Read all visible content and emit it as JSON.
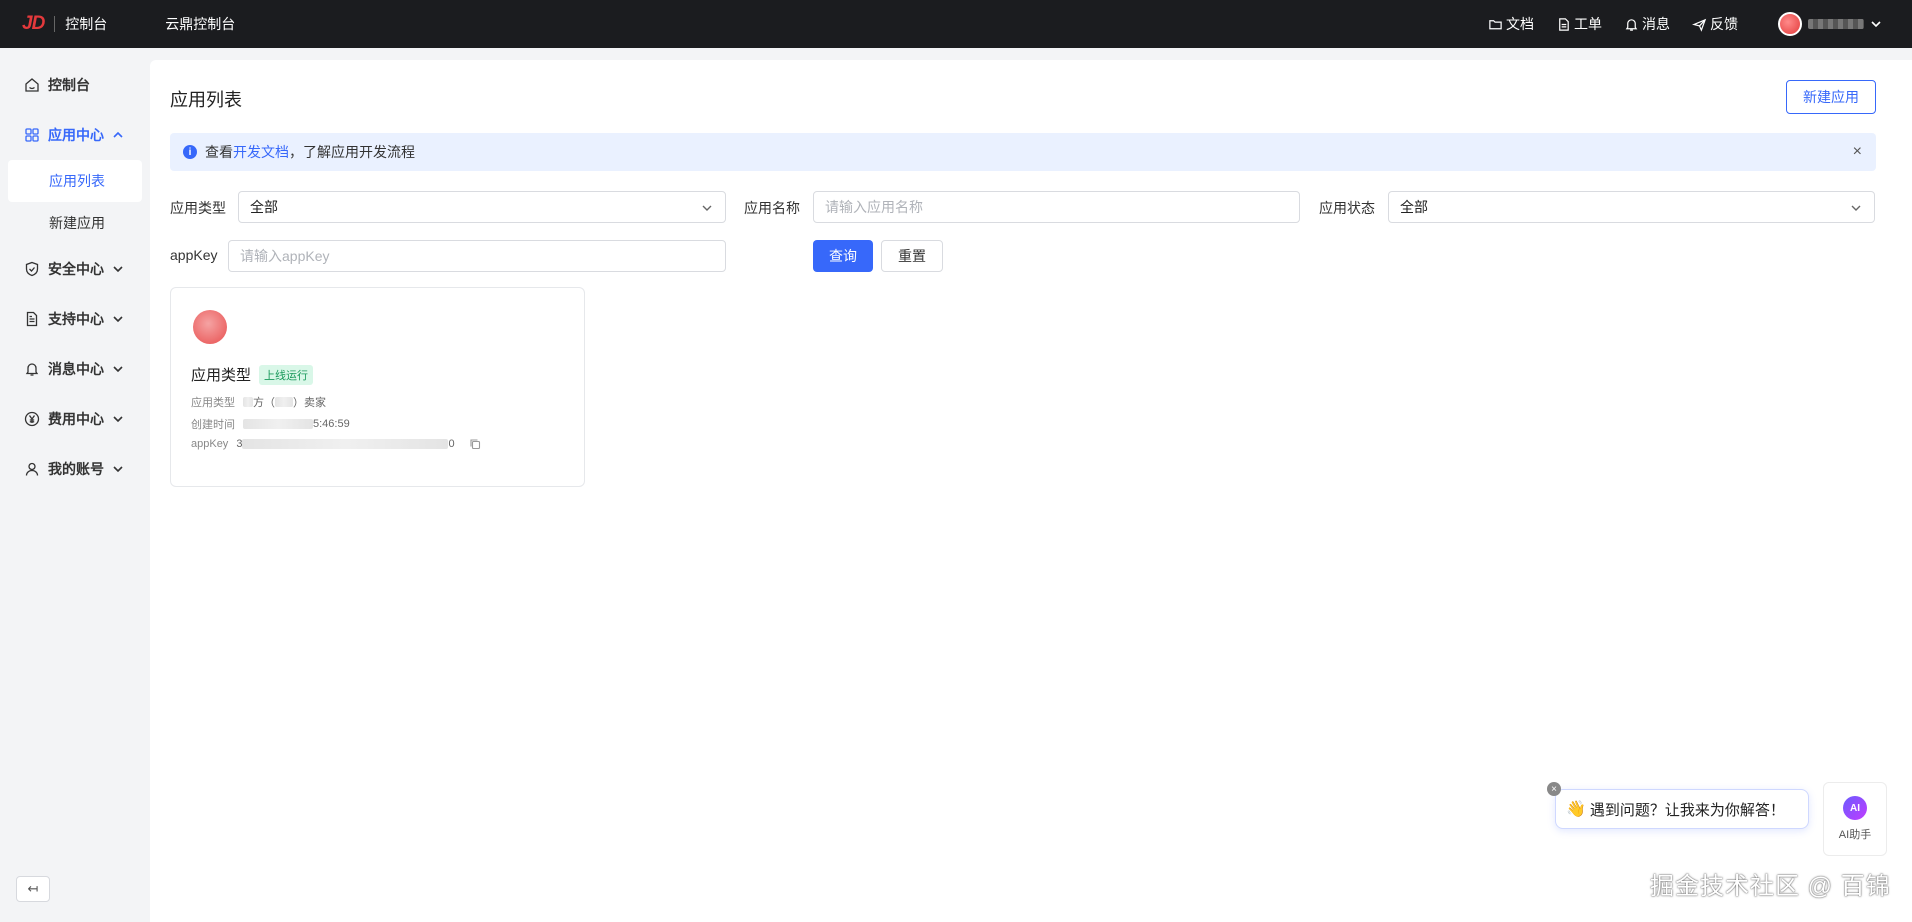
{
  "topbar": {
    "logo_mark": "JD",
    "logo_text": "控制台",
    "title": "云鼎控制台",
    "links": [
      {
        "label": "文档",
        "icon": "folder-icon"
      },
      {
        "label": "工单",
        "icon": "file-icon"
      },
      {
        "label": "消息",
        "icon": "bell-icon"
      },
      {
        "label": "反馈",
        "icon": "send-icon"
      }
    ]
  },
  "sidebar": {
    "items": [
      {
        "label": "控制台",
        "icon": "home-icon"
      },
      {
        "label": "应用中心",
        "icon": "apps-icon",
        "expanded": true,
        "children": [
          {
            "label": "应用列表",
            "active": true
          },
          {
            "label": "新建应用"
          }
        ]
      },
      {
        "label": "安全中心",
        "icon": "shield-icon"
      },
      {
        "label": "支持中心",
        "icon": "doc-icon"
      },
      {
        "label": "消息中心",
        "icon": "bell-icon"
      },
      {
        "label": "费用中心",
        "icon": "yen-icon"
      },
      {
        "label": "我的账号",
        "icon": "user-icon"
      }
    ],
    "collapse_label": "↤"
  },
  "main": {
    "title": "应用列表",
    "new_button": "新建应用",
    "alert": {
      "prefix": "查看",
      "link": "开发文档",
      "suffix": "，了解应用开发流程",
      "close": "×"
    },
    "filters": {
      "type_label": "应用类型",
      "type_value": "全部",
      "name_label": "应用名称",
      "name_placeholder": "请输入应用名称",
      "status_label": "应用状态",
      "status_value": "全部",
      "appkey_label": "appKey",
      "appkey_placeholder": "请输入appKey",
      "query": "查询",
      "reset": "重置"
    },
    "card": {
      "title": "应用类型",
      "status": "上线运行",
      "type_key": "应用类型",
      "type_value_mid": "方（",
      "type_value_end": "）卖家",
      "created_key": "创建时间",
      "created_value_end": "5:46:59",
      "appkey_key": "appKey",
      "appkey_start": "3",
      "appkey_end": "0"
    }
  },
  "assistant": {
    "bubble": "遇到问题？让我来为你解答！",
    "logo": "AI",
    "label": "AI助手",
    "close": "×"
  },
  "watermark": "掘金技术社区 @ 百锦",
  "colors": {
    "accent": "#3768fa",
    "topbar": "#1b1c1f",
    "success": "#1a9a5c"
  }
}
